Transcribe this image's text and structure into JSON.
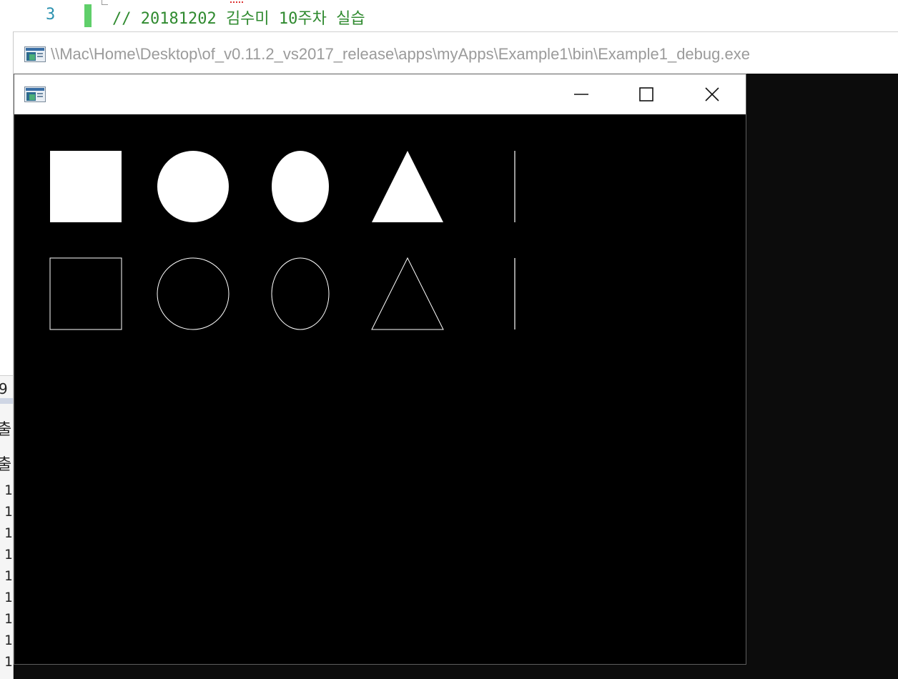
{
  "editor": {
    "line_number": "3",
    "code_comment": "// 20181202 김수미 10주차 실습"
  },
  "console_window": {
    "title": "\\\\Mac\\Home\\Desktop\\of_v0.11.2_vs2017_release\\apps\\myApps\\Example1\\bin\\Example1_debug.exe",
    "icon": "console-app-icon"
  },
  "output_panel": {
    "header_fragment": "9",
    "label_fragment_1": "출",
    "label_fragment_2": "출",
    "line_prefixes": [
      "1",
      "1",
      "1",
      "1",
      "1",
      "1",
      "1",
      "1",
      "1"
    ]
  },
  "app_window": {
    "title": "",
    "icon": "app-icon",
    "controls": [
      "minimize-icon",
      "maximize-icon",
      "close-icon"
    ],
    "canvas_background": "#000000",
    "shape_color": "#ffffff",
    "shapes": {
      "filled_row": [
        "rectangle",
        "circle",
        "ellipse",
        "triangle",
        "line"
      ],
      "outline_row": [
        "rectangle",
        "circle",
        "ellipse",
        "triangle",
        "line"
      ]
    }
  },
  "colors": {
    "comment_green": "#2f8a2f",
    "line_number_blue": "#2b91af",
    "change_bar_green": "#5fcf6a",
    "console_background": "#0c0c0c",
    "title_text_gray": "#9b9b9b"
  }
}
